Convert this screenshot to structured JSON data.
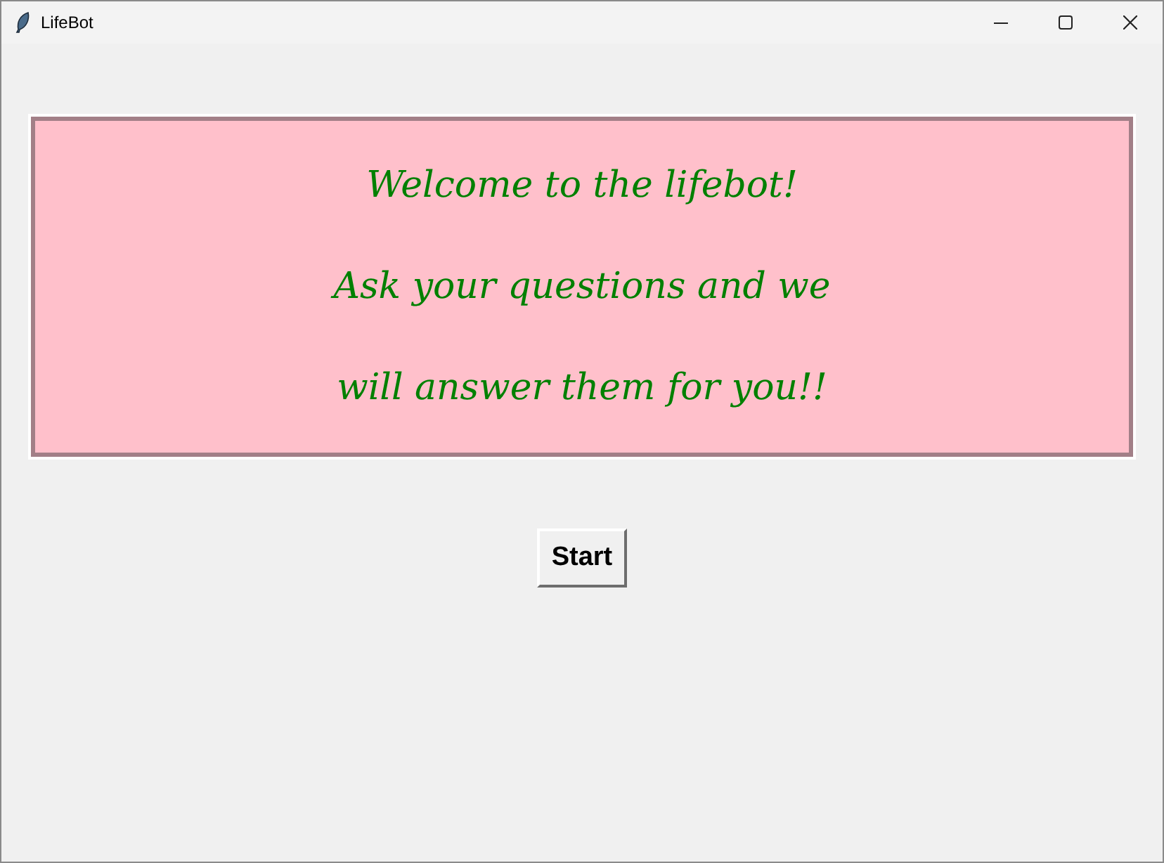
{
  "window": {
    "title": "LifeBot"
  },
  "banner": {
    "lines": [
      "Welcome to the lifebot!",
      "Ask your questions and we",
      "will answer them for you!!"
    ]
  },
  "buttons": [
    "Start"
  ]
}
